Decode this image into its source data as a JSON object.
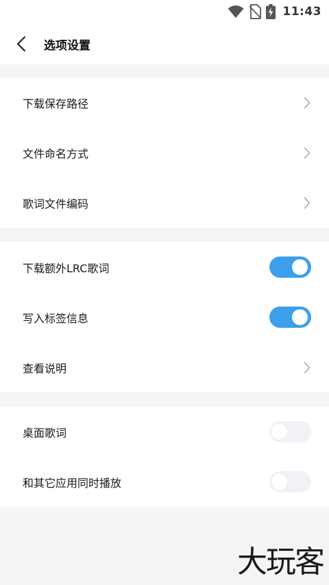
{
  "status_bar": {
    "time": "11:43",
    "icons": [
      "wifi-icon",
      "no-sim-icon",
      "battery-charging-icon"
    ]
  },
  "header": {
    "back_icon": "chevron-left-icon",
    "title": "选项设置"
  },
  "groups": [
    {
      "items": [
        {
          "label": "下载保存路径",
          "control": "chevron"
        },
        {
          "label": "文件命名方式",
          "control": "chevron"
        },
        {
          "label": "歌词文件编码",
          "control": "chevron"
        }
      ]
    },
    {
      "items": [
        {
          "label": "下载额外LRC歌词",
          "control": "toggle",
          "enabled": true
        },
        {
          "label": "写入标签信息",
          "control": "toggle",
          "enabled": true
        },
        {
          "label": "查看说明",
          "control": "chevron"
        }
      ]
    },
    {
      "items": [
        {
          "label": "桌面歌词",
          "control": "toggle",
          "enabled": false
        },
        {
          "label": "和其它应用同时播放",
          "control": "toggle",
          "enabled": false
        }
      ]
    }
  ],
  "colors": {
    "accent": "#3d9fea",
    "toggle_off": "#f1f2f5",
    "background": "#f5f5f5",
    "card": "#ffffff"
  },
  "watermark": "大玩客"
}
